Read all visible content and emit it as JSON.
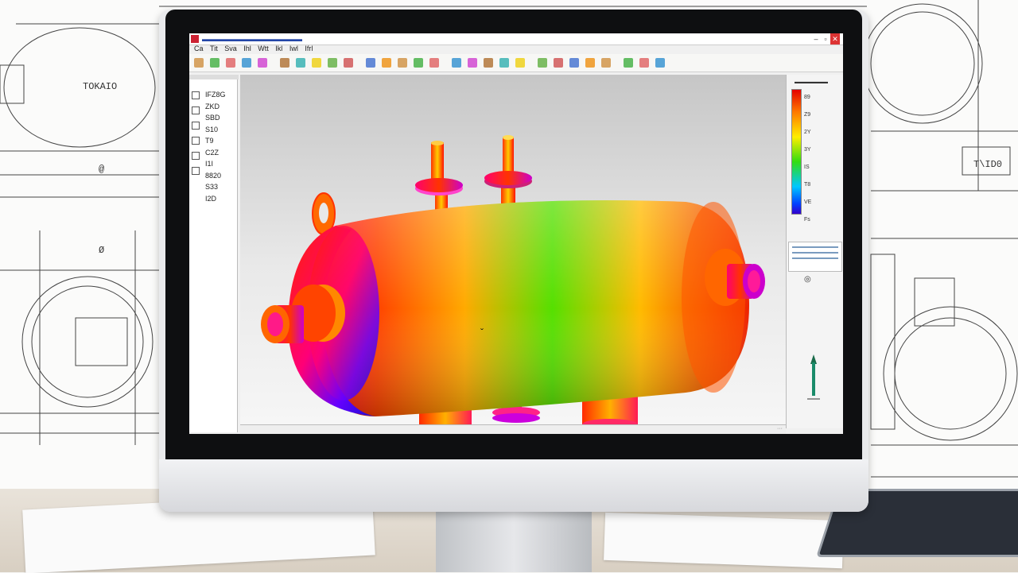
{
  "app": {
    "title": "▬▬▬▬▬▬▬▬▬▬▬▬▬▬",
    "window_buttons": [
      "–",
      "▫",
      "✕"
    ]
  },
  "menu": {
    "items": [
      "Ca",
      "Tit",
      "Sva",
      "Ihl",
      "Wtt",
      "Ikl",
      "Iwl",
      "Ifrl"
    ]
  },
  "toolbar": {
    "icons": [
      "file-icon",
      "save-icon",
      "scissors-icon",
      "copy-icon",
      "paste-icon",
      "undo-icon",
      "redo-icon",
      "select-icon",
      "zoom-icon",
      "rotate-icon",
      "pan-icon",
      "mesh-icon",
      "load-icon",
      "constraint-icon",
      "solve-icon",
      "plot-icon",
      "measure-icon",
      "section-icon",
      "view-front-icon",
      "view-top-icon",
      "view-iso-icon",
      "shade-icon",
      "wire-icon",
      "light-icon",
      "animate-icon",
      "report-icon",
      "settings-icon",
      "help-icon"
    ]
  },
  "tree": {
    "items": [
      "IFZ8G",
      "ZKD",
      "SBD",
      "S10",
      "T9",
      "C2Z",
      "I1I",
      "8820",
      "S33",
      "I2D"
    ]
  },
  "legend": {
    "title": "▬▬▬▬▬▬",
    "ticks": [
      "89",
      "Z9",
      "2Y",
      "3Y",
      "IS",
      "T8",
      "VE",
      "Fs"
    ]
  },
  "view": {
    "cursor_label": "ˇ"
  },
  "background": {
    "drawing_label_1": "TOKAIO",
    "drawing_label_2": "T\\ID0",
    "drawing_dim_1": "@",
    "drawing_dim_2": "Ø"
  },
  "colors": {
    "contour_max": "#e40000",
    "contour_mid": "#33dd11",
    "contour_min": "#3300cc",
    "titlebar_text": "#2446a8"
  }
}
